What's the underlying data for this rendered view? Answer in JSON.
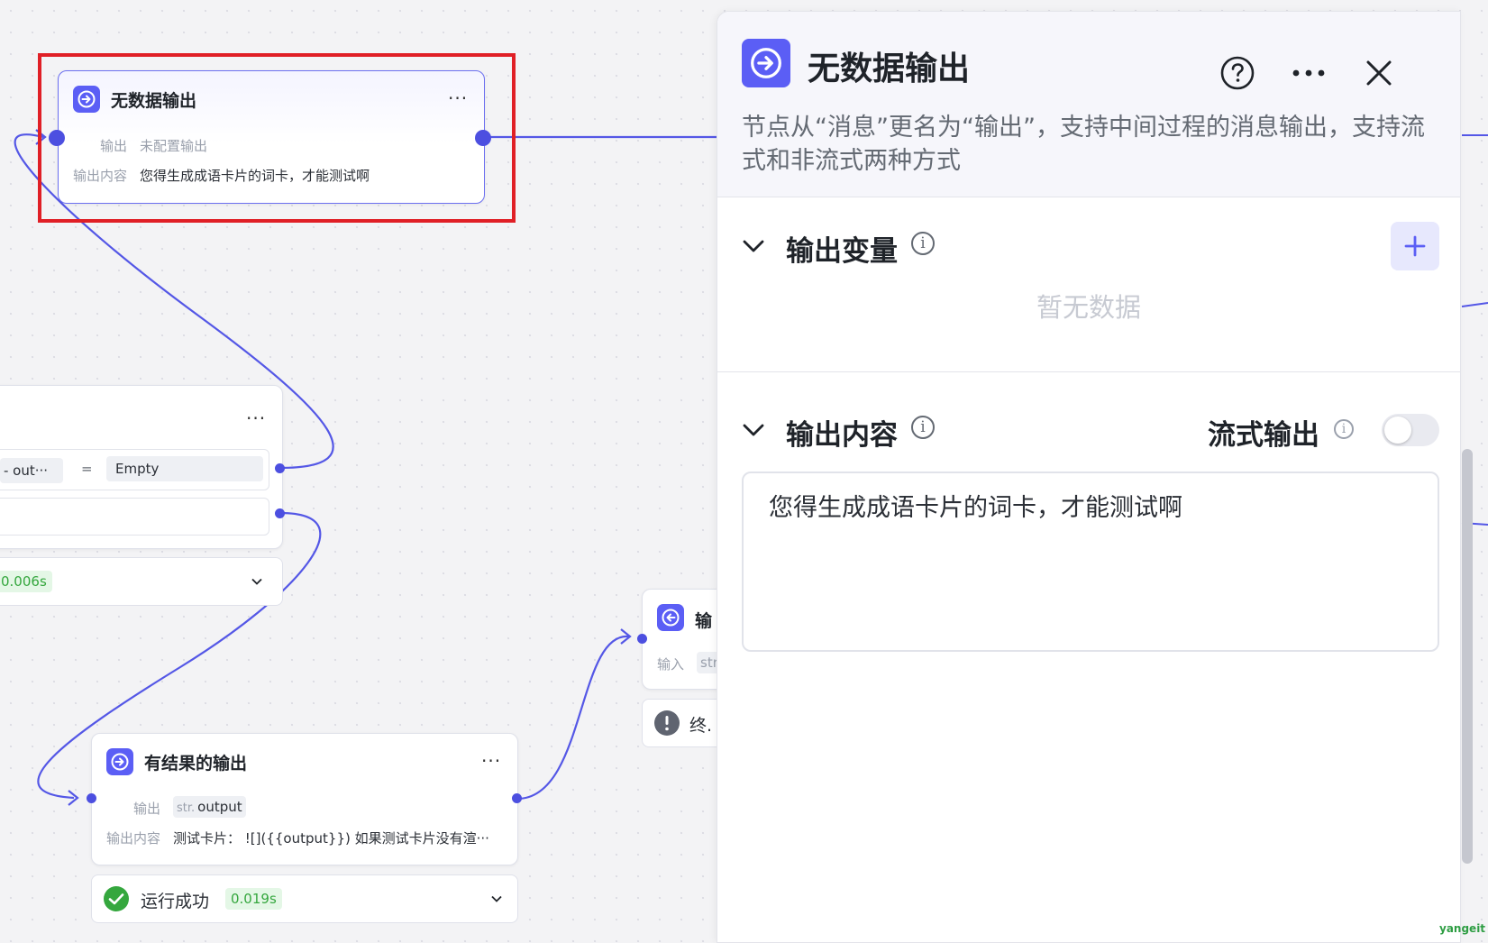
{
  "canvas": {
    "node_selected": {
      "title": "无数据输出",
      "more": "···",
      "output_label": "输出",
      "output_value": "未配置输出",
      "content_label": "输出内容",
      "content_value": "您得生成成语卡片的词卡，才能测试啊"
    },
    "condition_node": {
      "more": "···",
      "var_chip": "-  out···",
      "operator": "=",
      "compare_value": "Empty",
      "status_time": "0.006s"
    },
    "result_node": {
      "title": "有结果的输出",
      "more": "···",
      "output_label": "输出",
      "output_type": "str.",
      "output_value": "output",
      "content_label": "输出内容",
      "content_value": "测试卡片： ![]({{output}}) 如果测试卡片没有渲···",
      "status_text": "运行成功",
      "status_time": "0.019s"
    },
    "end_node": {
      "title_partial": "输",
      "input_label": "输入",
      "input_chip": "str",
      "status_partial": "终."
    }
  },
  "panel": {
    "title": "无数据输出",
    "description": "节点从“消息”更名为“输出”，支持中间过程的消息输出，支持流式和非流式两种方式",
    "section_vars": {
      "title": "输出变量",
      "empty_text": "暂无数据"
    },
    "section_content": {
      "title": "输出内容",
      "stream_label": "流式输出",
      "stream_enabled": false,
      "content": "您得生成成语卡片的词卡，才能测试啊"
    }
  },
  "watermark": "yangeit",
  "colors": {
    "accent": "#5b5ef5",
    "edge": "#5457e6",
    "highlight_box": "#e01f26",
    "success": "#35a73e"
  }
}
